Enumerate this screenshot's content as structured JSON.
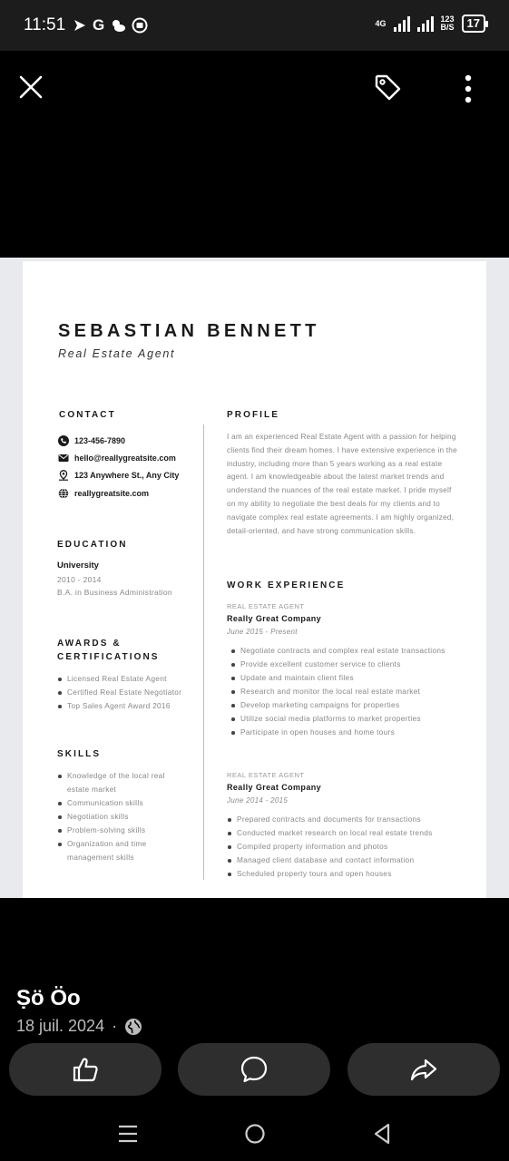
{
  "status_bar": {
    "time": "11:51",
    "left_icons": [
      "navigation-icon",
      "google-icon",
      "weather-icon",
      "record-icon"
    ],
    "network_label": "4G",
    "speed_value": "123",
    "speed_unit": "B/S",
    "battery": "17"
  },
  "viewer": {
    "icons": [
      "close-icon",
      "tag-icon",
      "more-vertical-icon"
    ]
  },
  "resume": {
    "name": "SEBASTIAN BENNETT",
    "role": "Real Estate Agent",
    "contact_heading": "CONTACT",
    "contact": {
      "phone": "123-456-7890",
      "email": "hello@reallygreatsite.com",
      "address": "123 Anywhere St., Any City",
      "website": "reallygreatsite.com"
    },
    "education_heading": "EDUCATION",
    "education": {
      "school": "University",
      "years": "2010 - 2014",
      "degree": "B.A. in Business Administration"
    },
    "awards_heading_1": "AWARDS &",
    "awards_heading_2": "CERTIFICATIONS",
    "awards": [
      "Licensed Real Estate Agent",
      "Certified Real Estate Negotiator",
      "Top Sales Agent Award 2016"
    ],
    "skills_heading": "SKILLS",
    "skills": [
      "Knowledge of the local real estate market",
      "Communication skills",
      "Negotiation skills",
      "Problem-solving skills",
      "Organization and time management skills"
    ],
    "profile_heading": "PROFILE",
    "profile_text": "I am an experienced Real Estate Agent with a passion for helping clients find their dream homes. I have extensive experience in the industry, including more than 5 years working as a real estate agent. I am knowledgeable about the latest market trends and understand the nuances of the real estate market. I pride myself on my ability to negotiate the best deals for my clients and to navigate complex real estate agreements. I am highly organized, detail-oriented, and have strong communication skills.",
    "work_heading": "WORK EXPERIENCE",
    "jobs": [
      {
        "title": "REAL ESTATE AGENT",
        "company": "Really Great Company",
        "dates": "June 2015 - Present",
        "duties": [
          "Negotiate contracts and complex real estate transactions",
          "Provide excellent customer service to clients",
          "Update and maintain client files",
          "Research and monitor the local real estate market",
          "Develop marketing campaigns for properties",
          "Utilize social media platforms to market properties",
          "Participate in open houses and home tours"
        ]
      },
      {
        "title": "REAL ESTATE AGENT",
        "company": "Really Great Company",
        "dates": "June 2014 - 2015",
        "duties": [
          "Prepared contracts and documents for transactions",
          "Conducted market research on local real estate trends",
          "Compiled property information and photos",
          "Managed client database and contact information",
          "Scheduled property tours and open houses"
        ]
      }
    ]
  },
  "post": {
    "author": "Ṣö Öo",
    "date": "18 juil. 2024",
    "separator": "·"
  },
  "actions": [
    "like-icon",
    "comment-icon",
    "share-icon"
  ],
  "navigation": [
    "recent-apps-icon",
    "home-icon",
    "back-icon"
  ]
}
